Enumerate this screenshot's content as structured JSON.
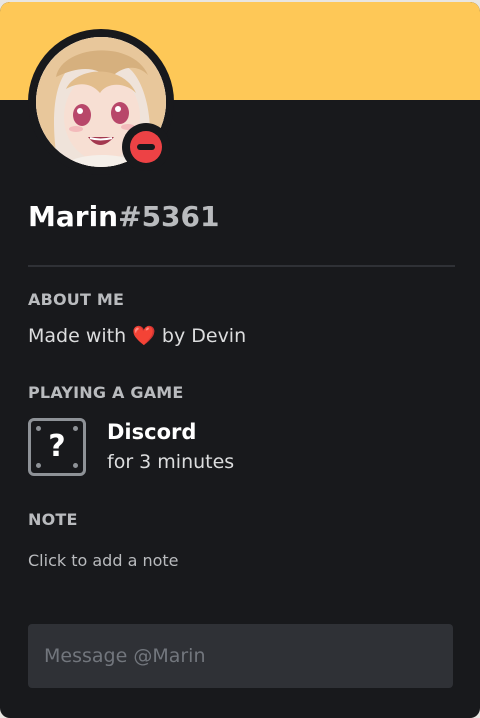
{
  "profile": {
    "username": "Marin",
    "discriminator": "#5361",
    "status": "do-not-disturb",
    "avatar_icon": "anime-girl-avatar"
  },
  "sections": {
    "about_me_title": "ABOUT ME",
    "about_me_text_before": "Made with ",
    "about_me_emoji": "❤️",
    "about_me_text_after": " by Devin",
    "playing_title": "PLAYING A GAME",
    "game_icon": "question-mark-icon",
    "game_icon_glyph": "?",
    "game_name": "Discord",
    "game_time": "for 3 minutes",
    "note_title": "NOTE",
    "note_placeholder": "Click to add a note"
  },
  "message": {
    "placeholder": "Message @Marin"
  },
  "colors": {
    "banner": "#fec857",
    "card_bg": "#18191c",
    "status_dnd": "#ed4245",
    "input_bg": "#2f3136"
  }
}
